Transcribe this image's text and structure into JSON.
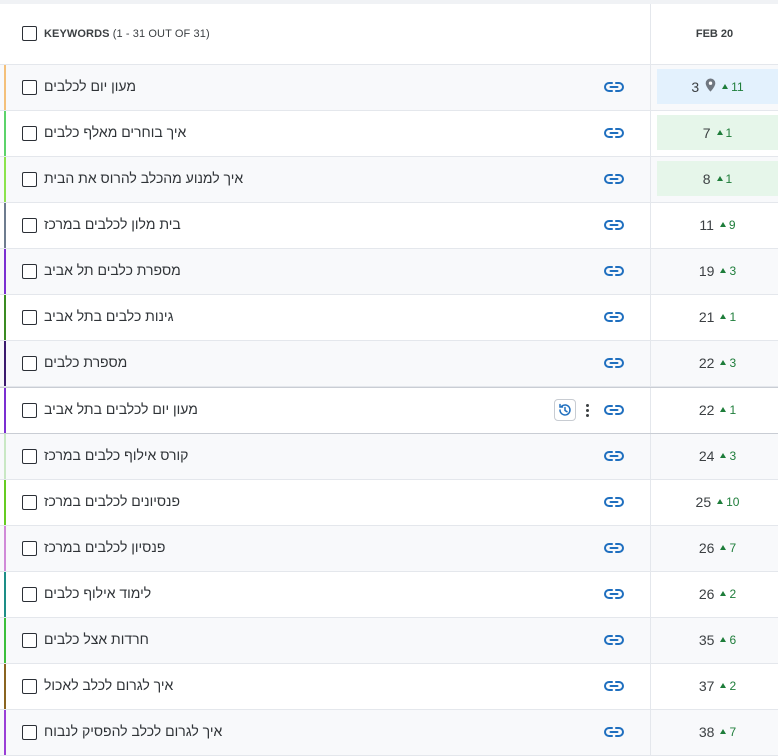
{
  "header": {
    "title": "KEYWORDS",
    "count": "(1 - 31 OUT OF 31)",
    "date": "FEB 20"
  },
  "colors": {
    "link": "#1f6fbf",
    "up": "#1e7d3a",
    "highlight_blue": "#e3f1fd",
    "highlight_green": "#e6f6ea"
  },
  "rows": [
    {
      "keyword": "מעון יום לכלבים",
      "rank": "3",
      "change": "11",
      "bar": "#f4c07a",
      "local": true,
      "highlight": "blue"
    },
    {
      "keyword": "איך בוחרים מאלף כלבים",
      "rank": "7",
      "change": "1",
      "bar": "#5cd36a",
      "highlight": "green"
    },
    {
      "keyword": "איך למנוע מהכלב להרוס את הבית",
      "rank": "8",
      "change": "1",
      "bar": "#8be34c",
      "highlight": "green"
    },
    {
      "keyword": "בית מלון לכלבים במרכז",
      "rank": "11",
      "change": "9",
      "bar": "#6e7c8f"
    },
    {
      "keyword": "מספרת כלבים תל אביב",
      "rank": "19",
      "change": "3",
      "bar": "#7b2fd1"
    },
    {
      "keyword": "גינות כלבים בתל אביב",
      "rank": "21",
      "change": "1",
      "bar": "#3b8b22"
    },
    {
      "keyword": "מספרת כלבים",
      "rank": "22",
      "change": "3",
      "bar": "#3b1a6e"
    },
    {
      "keyword": "מעון יום לכלבים בתל אביב",
      "rank": "22",
      "change": "1",
      "bar": "#7b2fd1",
      "hover": true
    },
    {
      "keyword": "קורס אילוף כלבים במרכז",
      "rank": "24",
      "change": "3",
      "bar": "#c9e8c4"
    },
    {
      "keyword": "פנסיונים לכלבים במרכז",
      "rank": "25",
      "change": "10",
      "bar": "#66cc22"
    },
    {
      "keyword": "פנסיון לכלבים במרכז",
      "rank": "26",
      "change": "7",
      "bar": "#d08ad8"
    },
    {
      "keyword": "לימוד אילוף כלבים",
      "rank": "26",
      "change": "2",
      "bar": "#1d8e87"
    },
    {
      "keyword": "חרדות אצל כלבים",
      "rank": "35",
      "change": "6",
      "bar": "#3bbf3b"
    },
    {
      "keyword": "איך לגרום לכלב לאכול",
      "rank": "37",
      "change": "2",
      "bar": "#8a6420"
    },
    {
      "keyword": "איך לגרום לכלב להפסיק לנבוח",
      "rank": "38",
      "change": "7",
      "bar": "#9a3fd6"
    }
  ]
}
